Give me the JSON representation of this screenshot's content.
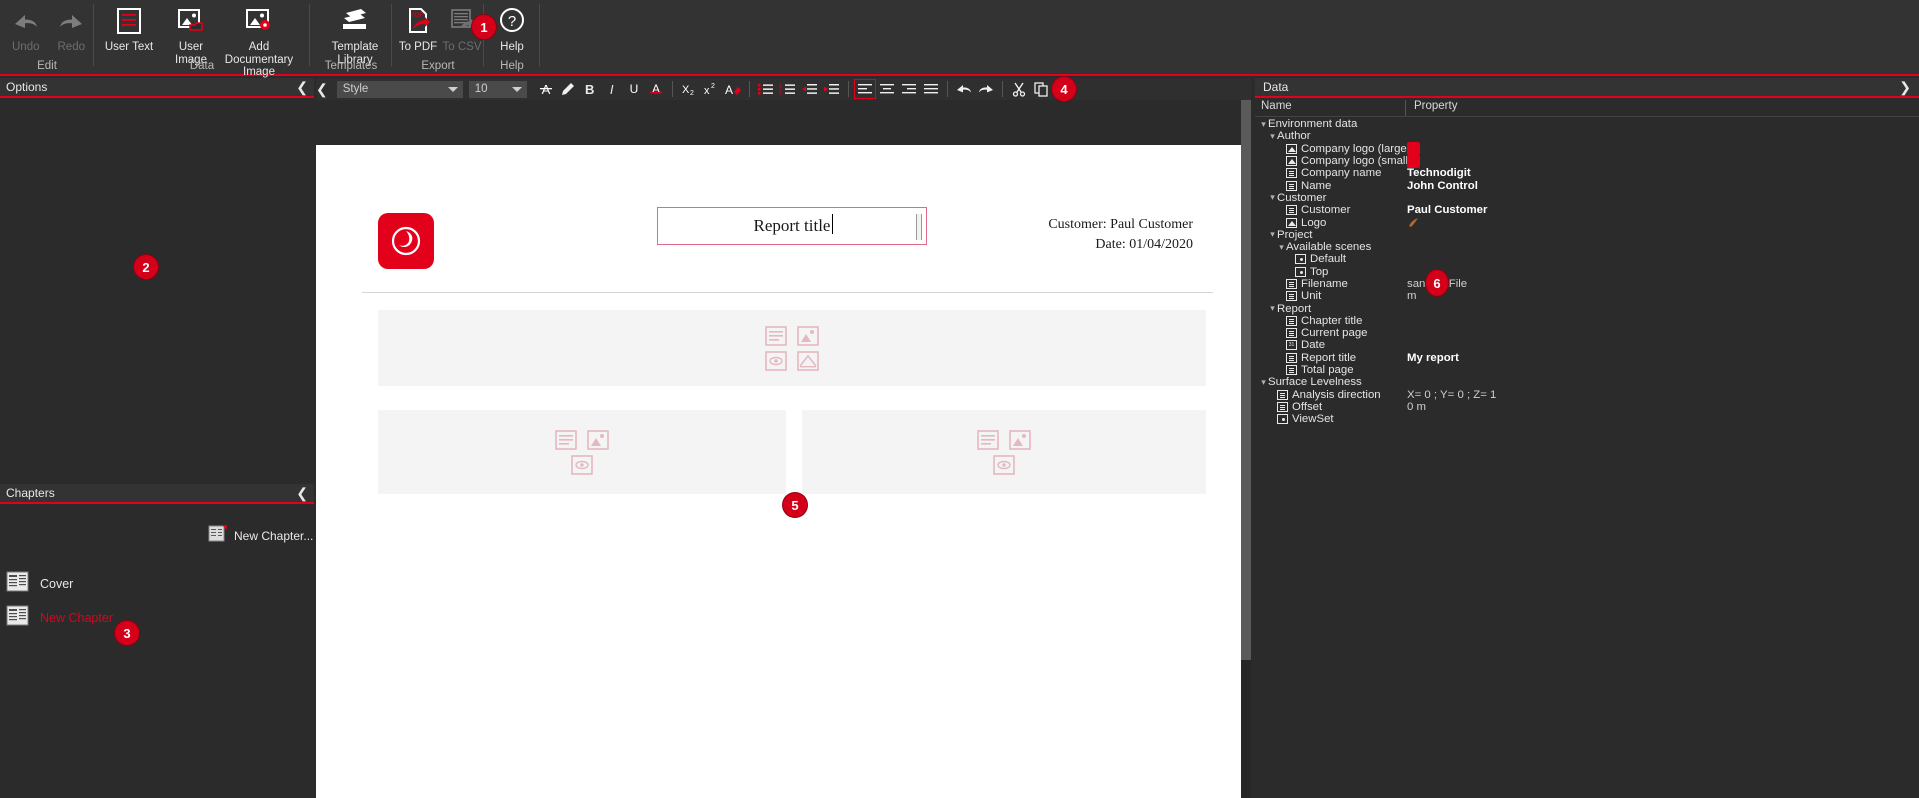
{
  "ribbon": {
    "groups": [
      {
        "label": "Edit",
        "buttons": [
          {
            "name": "undo-button",
            "label": "Undo",
            "icon": "undo-arrow-icon",
            "disabled": true
          },
          {
            "name": "redo-button",
            "label": "Redo",
            "icon": "redo-arrow-icon",
            "disabled": true
          }
        ]
      },
      {
        "label": "Data",
        "buttons": [
          {
            "name": "user-text-button",
            "label": "User Text",
            "icon": "text-lines-icon",
            "disabled": false
          },
          {
            "name": "user-image-button",
            "label": "User Image",
            "icon": "image-folder-icon",
            "disabled": false
          },
          {
            "name": "add-documentary-image-button",
            "label": "Add Documentary Image",
            "icon": "image-camera-icon",
            "disabled": false
          }
        ]
      },
      {
        "label": "Templates",
        "buttons": [
          {
            "name": "template-library-button",
            "label": "Template Library",
            "icon": "book-stack-icon",
            "disabled": false
          }
        ]
      },
      {
        "label": "Export",
        "buttons": [
          {
            "name": "to-pdf-button",
            "label": "To PDF",
            "icon": "pdf-export-icon",
            "disabled": false
          },
          {
            "name": "to-csv-button",
            "label": "To CSV",
            "icon": "csv-export-icon",
            "disabled": true
          }
        ]
      },
      {
        "label": "Help",
        "buttons": [
          {
            "name": "help-button",
            "label": "Help",
            "icon": "question-circle-icon",
            "disabled": false
          }
        ]
      }
    ]
  },
  "format_toolbar": {
    "style_value": "Style",
    "style_placeholder": "Style",
    "size_value": "10",
    "buttons": [
      {
        "name": "font-color-button",
        "label": "A",
        "title": "Font color"
      },
      {
        "name": "highlight-button",
        "label": "",
        "title": "Highlight"
      },
      {
        "name": "bold-button",
        "label": "B",
        "title": "Bold"
      },
      {
        "name": "italic-button",
        "label": "I",
        "title": "Italic"
      },
      {
        "name": "underline-button",
        "label": "U",
        "title": "Underline"
      },
      {
        "name": "strikethrough-button",
        "label": "A",
        "title": "Strikethrough"
      },
      {
        "name": "subscript-button",
        "label": "X2",
        "title": "Subscript"
      },
      {
        "name": "superscript-button",
        "label": "x2",
        "title": "Superscript"
      },
      {
        "name": "clear-formatting-button",
        "label": "A",
        "title": "Clear formatting"
      },
      {
        "name": "bullet-list-button",
        "label": "",
        "title": "Bulleted list"
      },
      {
        "name": "numbered-list-button",
        "label": "",
        "title": "Numbered list"
      },
      {
        "name": "decrease-indent-button",
        "label": "",
        "title": "Decrease indent"
      },
      {
        "name": "increase-indent-button",
        "label": "",
        "title": "Increase indent"
      },
      {
        "name": "align-left-button",
        "label": "",
        "title": "Align left",
        "active": true
      },
      {
        "name": "align-center-button",
        "label": "",
        "title": "Align center"
      },
      {
        "name": "align-right-button",
        "label": "",
        "title": "Align right"
      },
      {
        "name": "align-justify-button",
        "label": "",
        "title": "Justify"
      },
      {
        "name": "undo-button",
        "label": "",
        "title": "Undo"
      },
      {
        "name": "redo-button",
        "label": "",
        "title": "Redo"
      },
      {
        "name": "cut-button",
        "label": "",
        "title": "Cut"
      },
      {
        "name": "copy-button",
        "label": "",
        "title": "Copy"
      },
      {
        "name": "paste-button",
        "label": "",
        "title": "Paste"
      }
    ]
  },
  "options_panel": {
    "title": "Options"
  },
  "chapters_panel": {
    "title": "Chapters",
    "new_chapter_label": "New Chapter...",
    "items": [
      {
        "label": "Cover",
        "selected": false
      },
      {
        "label": "New Chapter",
        "selected": true
      }
    ]
  },
  "document": {
    "title": "Report title",
    "customer_label": "Customer:",
    "customer_value": "Paul Customer",
    "date_label": "Date:",
    "date_value": "01/04/2020"
  },
  "data_panel": {
    "title": "Data",
    "col_name": "Name",
    "col_property": "Property",
    "rows": [
      {
        "indent": 0,
        "twist": "v",
        "icon": "none",
        "name": "Environment data",
        "prop": "",
        "bold": false
      },
      {
        "indent": 1,
        "twist": "v",
        "icon": "none",
        "name": "Author",
        "prop": "",
        "bold": false
      },
      {
        "indent": 2,
        "twist": "",
        "icon": "image",
        "name": "Company logo (large)",
        "prop": "logo-swatch",
        "bold": false
      },
      {
        "indent": 2,
        "twist": "",
        "icon": "image",
        "name": "Company logo (small)",
        "prop": "logo-swatch",
        "bold": false
      },
      {
        "indent": 2,
        "twist": "",
        "icon": "text",
        "name": "Company name",
        "prop": "Technodigit",
        "bold": true
      },
      {
        "indent": 2,
        "twist": "",
        "icon": "text",
        "name": "Name",
        "prop": "John Control",
        "bold": true
      },
      {
        "indent": 1,
        "twist": "v",
        "icon": "none",
        "name": "Customer",
        "prop": "",
        "bold": false
      },
      {
        "indent": 2,
        "twist": "",
        "icon": "text",
        "name": "Customer",
        "prop": "Paul Customer",
        "bold": true
      },
      {
        "indent": 2,
        "twist": "",
        "icon": "image",
        "name": "Logo",
        "prop": "cust-swatch",
        "bold": false
      },
      {
        "indent": 1,
        "twist": "v",
        "icon": "none",
        "name": "Project",
        "prop": "",
        "bold": false
      },
      {
        "indent": 2,
        "twist": "v",
        "icon": "none",
        "name": "Available scenes",
        "prop": "",
        "bold": false
      },
      {
        "indent": 3,
        "twist": "",
        "icon": "eye",
        "name": "Default",
        "prop": "",
        "bold": false
      },
      {
        "indent": 3,
        "twist": "",
        "icon": "eye",
        "name": "Top",
        "prop": "",
        "bold": false
      },
      {
        "indent": 2,
        "twist": "",
        "icon": "text",
        "name": "Filename",
        "prop": "saniTestFile",
        "bold": false
      },
      {
        "indent": 2,
        "twist": "",
        "icon": "text",
        "name": "Unit",
        "prop": "m",
        "bold": false
      },
      {
        "indent": 1,
        "twist": "v",
        "icon": "none",
        "name": "Report",
        "prop": "",
        "bold": false
      },
      {
        "indent": 2,
        "twist": "",
        "icon": "text",
        "name": "Chapter title",
        "prop": "",
        "bold": false
      },
      {
        "indent": 2,
        "twist": "",
        "icon": "text",
        "name": "Current page",
        "prop": "",
        "bold": false
      },
      {
        "indent": 2,
        "twist": "",
        "icon": "date",
        "name": "Date",
        "prop": "",
        "bold": false
      },
      {
        "indent": 2,
        "twist": "",
        "icon": "text",
        "name": "Report title",
        "prop": "My report",
        "bold": true
      },
      {
        "indent": 2,
        "twist": "",
        "icon": "text",
        "name": "Total page",
        "prop": "",
        "bold": false
      },
      {
        "indent": 0,
        "twist": "v",
        "icon": "none",
        "name": "Surface Levelness",
        "prop": "",
        "bold": false
      },
      {
        "indent": 1,
        "twist": "",
        "icon": "text",
        "name": "Analysis direction",
        "prop": "X= 0 ; Y= 0 ; Z= 1",
        "bold": false
      },
      {
        "indent": 1,
        "twist": "",
        "icon": "text",
        "name": "Offset",
        "prop": "0 m",
        "bold": false
      },
      {
        "indent": 1,
        "twist": "",
        "icon": "eye",
        "name": "ViewSet",
        "prop": "",
        "bold": false
      }
    ]
  },
  "markers": [
    {
      "id": "m1",
      "label": "1"
    },
    {
      "id": "m2",
      "label": "2"
    },
    {
      "id": "m3",
      "label": "3"
    },
    {
      "id": "m4",
      "label": "4"
    },
    {
      "id": "m5",
      "label": "5"
    },
    {
      "id": "m6",
      "label": "6"
    }
  ],
  "colors": {
    "accent": "#e2001a",
    "marker": "#d40019",
    "panel_bg": "#2b2b2b",
    "ribbon_bg": "#333333",
    "text": "#e8e8e8",
    "disabled_text": "#6e6e6e"
  }
}
